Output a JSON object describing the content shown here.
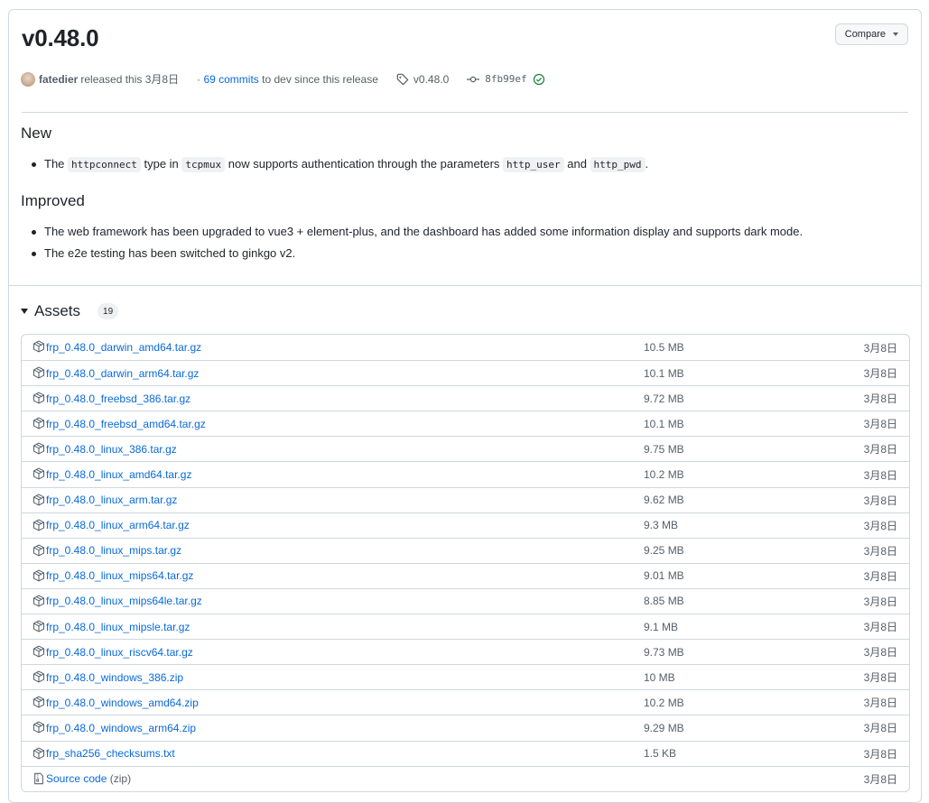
{
  "release": {
    "title": "v0.48.0",
    "compare_label": "Compare",
    "author": "fatedier",
    "released_text": "released this 3月8日",
    "commits_link": "69 commits",
    "commits_suffix": "to dev since this release",
    "tag": "v0.48.0",
    "commit_sha": "8fb99ef"
  },
  "notes": {
    "new_heading": "New",
    "new_item": {
      "p1": "The ",
      "c1": "httpconnect",
      "p2": " type in ",
      "c2": "tcpmux",
      "p3": " now supports authentication through the parameters ",
      "c3": "http_user",
      "p4": " and ",
      "c4": "http_pwd",
      "p5": "."
    },
    "improved_heading": "Improved",
    "improved_items": [
      "The web framework has been upgraded to vue3 + element-plus, and the dashboard has added some information display and supports dark mode.",
      "The e2e testing has been switched to ginkgo v2."
    ]
  },
  "assets": {
    "title": "Assets",
    "count": "19",
    "rows": [
      {
        "name": "frp_0.48.0_darwin_amd64.tar.gz",
        "size": "10.5 MB",
        "date": "3月8日"
      },
      {
        "name": "frp_0.48.0_darwin_arm64.tar.gz",
        "size": "10.1 MB",
        "date": "3月8日"
      },
      {
        "name": "frp_0.48.0_freebsd_386.tar.gz",
        "size": "9.72 MB",
        "date": "3月8日"
      },
      {
        "name": "frp_0.48.0_freebsd_amd64.tar.gz",
        "size": "10.1 MB",
        "date": "3月8日"
      },
      {
        "name": "frp_0.48.0_linux_386.tar.gz",
        "size": "9.75 MB",
        "date": "3月8日"
      },
      {
        "name": "frp_0.48.0_linux_amd64.tar.gz",
        "size": "10.2 MB",
        "date": "3月8日"
      },
      {
        "name": "frp_0.48.0_linux_arm.tar.gz",
        "size": "9.62 MB",
        "date": "3月8日"
      },
      {
        "name": "frp_0.48.0_linux_arm64.tar.gz",
        "size": "9.3 MB",
        "date": "3月8日"
      },
      {
        "name": "frp_0.48.0_linux_mips.tar.gz",
        "size": "9.25 MB",
        "date": "3月8日"
      },
      {
        "name": "frp_0.48.0_linux_mips64.tar.gz",
        "size": "9.01 MB",
        "date": "3月8日"
      },
      {
        "name": "frp_0.48.0_linux_mips64le.tar.gz",
        "size": "8.85 MB",
        "date": "3月8日"
      },
      {
        "name": "frp_0.48.0_linux_mipsle.tar.gz",
        "size": "9.1 MB",
        "date": "3月8日"
      },
      {
        "name": "frp_0.48.0_linux_riscv64.tar.gz",
        "size": "9.73 MB",
        "date": "3月8日"
      },
      {
        "name": "frp_0.48.0_windows_386.zip",
        "size": "10 MB",
        "date": "3月8日"
      },
      {
        "name": "frp_0.48.0_windows_amd64.zip",
        "size": "10.2 MB",
        "date": "3月8日"
      },
      {
        "name": "frp_0.48.0_windows_arm64.zip",
        "size": "9.29 MB",
        "date": "3月8日"
      },
      {
        "name": "frp_sha256_checksums.txt",
        "size": "1.5 KB",
        "date": "3月8日"
      }
    ],
    "source_row": {
      "name": "Source code",
      "suffix": "(zip)",
      "date": "3月8日"
    }
  },
  "colors": {
    "link": "#0969da",
    "border": "#d0d7de",
    "muted": "#57606a",
    "verified": "#1a7f37"
  }
}
